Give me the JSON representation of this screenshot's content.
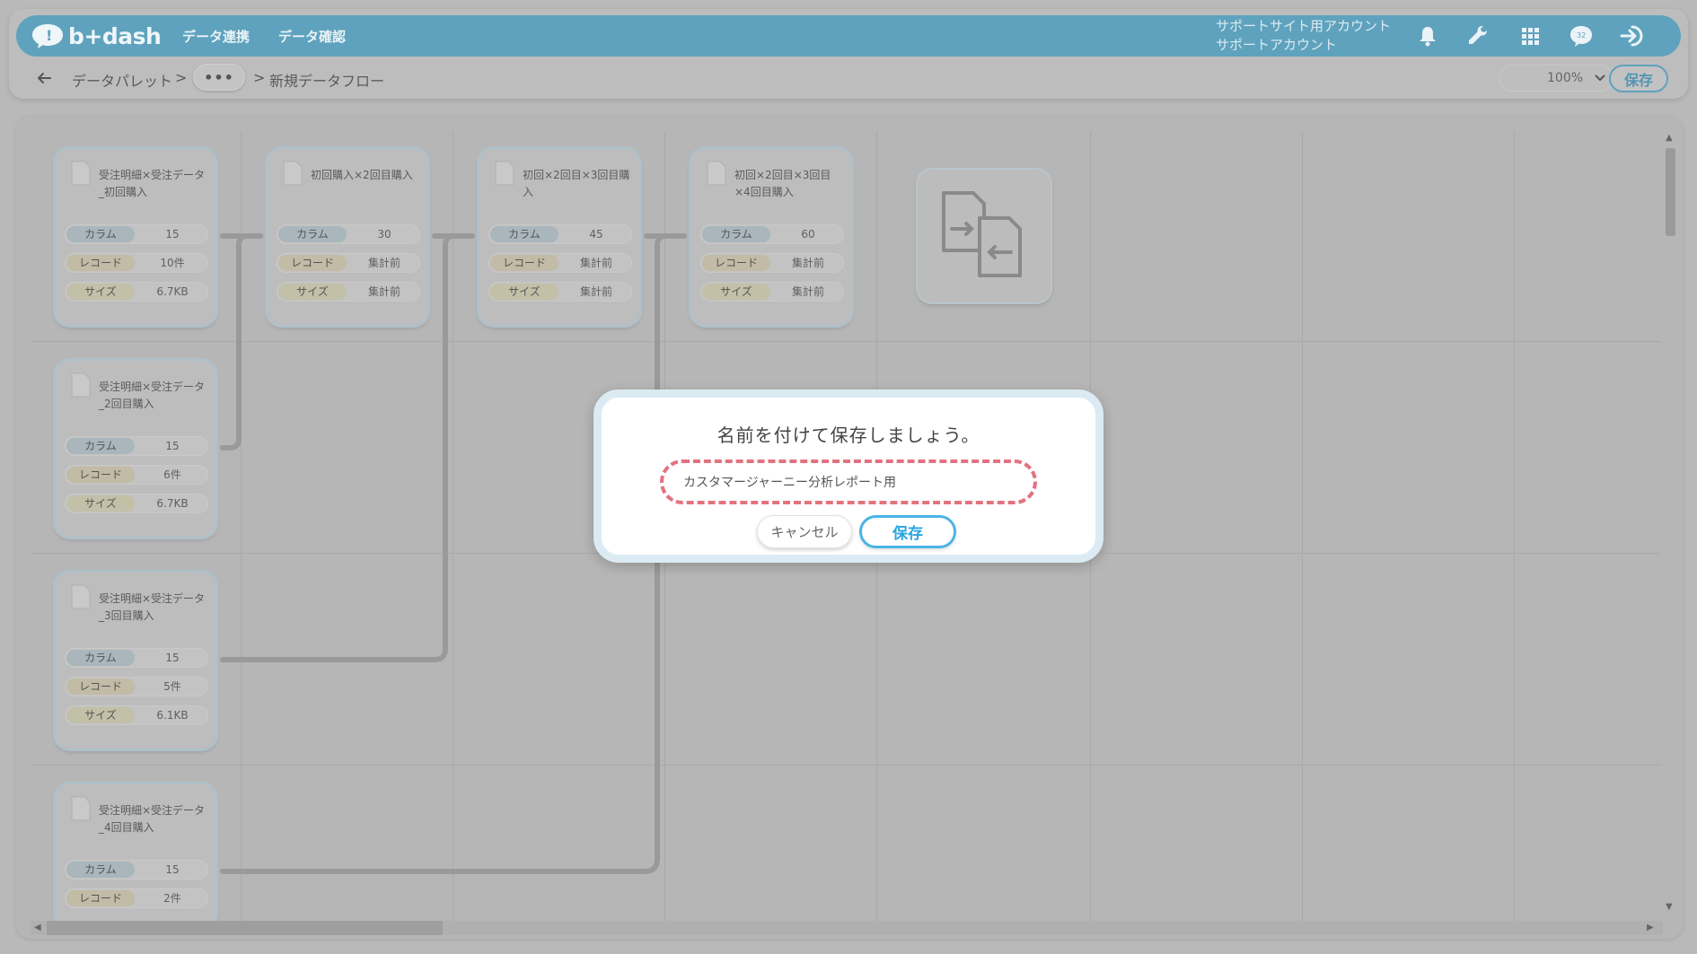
{
  "header": {
    "logo_text": "b+dash",
    "nav": [
      "データ連携",
      "データ確認"
    ],
    "account_line1": "サポートサイト用アカウント",
    "account_line2": "サポートアカウント",
    "notification_badge": "32"
  },
  "toolbar": {
    "breadcrumb_root": "データパレット",
    "breadcrumb_sep": ">",
    "breadcrumb_more": "•••",
    "breadcrumb_current": "新規データフロー",
    "zoom": "100%",
    "save_label": "保存"
  },
  "stat_labels": {
    "columns": "カラム",
    "records": "レコード",
    "size": "サイズ"
  },
  "nodes": [
    {
      "title": "受注明細×受注データ_初回購入",
      "columns": "15",
      "records": "10件",
      "size": "6.7KB"
    },
    {
      "title": "初回購入×2回目購入",
      "columns": "30",
      "records": "集計前",
      "size": "集計前"
    },
    {
      "title": "初回×2回目×3回目購入",
      "columns": "45",
      "records": "集計前",
      "size": "集計前"
    },
    {
      "title": "初回×2回目×3回目×4回目購入",
      "columns": "60",
      "records": "集計前",
      "size": "集計前"
    },
    {
      "title": "受注明細×受注データ_2回目購入",
      "columns": "15",
      "records": "6件",
      "size": "6.7KB"
    },
    {
      "title": "受注明細×受注データ_3回目購入",
      "columns": "15",
      "records": "5件",
      "size": "6.1KB"
    },
    {
      "title": "受注明細×受注データ_4回目購入",
      "columns": "15",
      "records": "2件"
    }
  ],
  "dialog": {
    "title": "名前を付けて保存しましょう。",
    "input_value": "カスタマージャーニー分析レポート用",
    "cancel_label": "キャンセル",
    "save_label": "保存"
  },
  "colors": {
    "header": "#5fa2bd",
    "accent": "#2ba4df",
    "highlight": "#e3727f"
  }
}
